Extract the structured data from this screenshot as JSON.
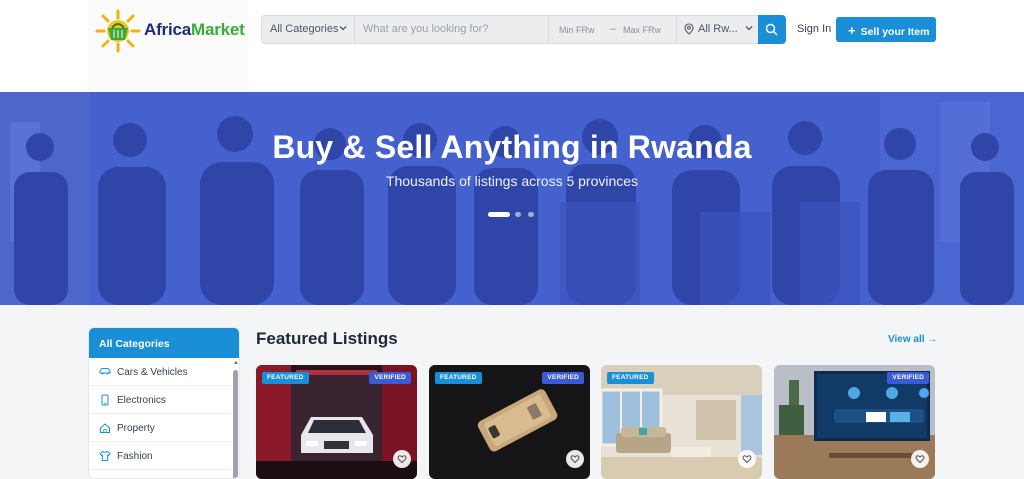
{
  "brand": {
    "name_part1": "Africa",
    "name_part2": "Market"
  },
  "header": {
    "category_select": "All Categories",
    "search_placeholder": "What are you looking for?",
    "min_price_placeholder": "Min FRw",
    "price_dash": "–",
    "max_price_placeholder": "Max FRw",
    "location_select": "All Rw...",
    "sign_in": "Sign In",
    "sell_button": "Sell your Item",
    "sell_plus": "+"
  },
  "hero": {
    "title": "Buy & Sell Anything in Rwanda",
    "subtitle": "Thousands of listings across 5 provinces",
    "slides_total": 3,
    "active_slide": 1
  },
  "sidebar": {
    "title": "All Categories",
    "items": [
      {
        "label": "Cars & Vehicles",
        "icon": "car-icon"
      },
      {
        "label": "Electronics",
        "icon": "phone-icon"
      },
      {
        "label": "Property",
        "icon": "house-icon"
      },
      {
        "label": "Fashion",
        "icon": "shirt-icon"
      }
    ],
    "scroll_up": "▲"
  },
  "featured": {
    "title": "Featured Listings",
    "view_all": "View all →",
    "listings": [
      {
        "featured": "FEATURED",
        "verified": "VERIFIED",
        "image": "white-car-in-garage"
      },
      {
        "featured": "FEATURED",
        "verified": "VERIFIED",
        "image": "phone-on-dark"
      },
      {
        "featured": "FEATURED",
        "verified": "",
        "image": "living-room"
      },
      {
        "featured": "",
        "verified": "VERIFIED",
        "image": "smart-tv"
      }
    ]
  },
  "colors": {
    "accent": "#1a8fd8",
    "verified": "#3b5bd6",
    "brand_dark": "#1e2a78",
    "brand_green": "#3daa35",
    "hero_blue": "#3b5bd0"
  }
}
